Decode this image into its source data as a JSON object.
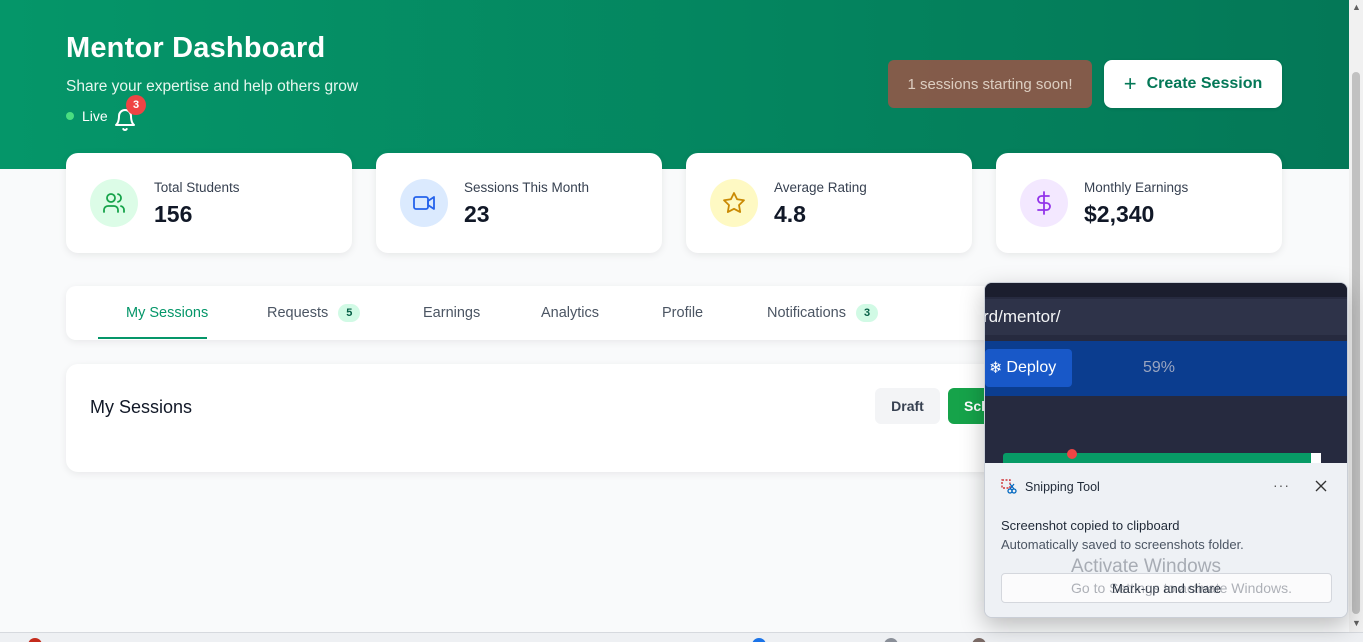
{
  "header": {
    "title": "Mentor Dashboard",
    "subtitle": "Share your expertise and help others grow",
    "live_label": "Live",
    "notification_count": "3",
    "toast": "1 sessions starting soon!",
    "create_label": "Create Session",
    "background_color": "#059669"
  },
  "stats": [
    {
      "label": "Total Students",
      "value": "156",
      "icon": "users-icon",
      "icon_bg": "#dcfce7",
      "icon_color": "#16a34a"
    },
    {
      "label": "Sessions This Month",
      "value": "23",
      "icon": "video-icon",
      "icon_bg": "#dbeafe",
      "icon_color": "#2563eb"
    },
    {
      "label": "Average Rating",
      "value": "4.8",
      "icon": "star-icon",
      "icon_bg": "#fef9c3",
      "icon_color": "#ca8a04"
    },
    {
      "label": "Monthly Earnings",
      "value": "$2,340",
      "icon": "dollar-icon",
      "icon_bg": "#f3e8ff",
      "icon_color": "#9333ea"
    }
  ],
  "tabs": [
    {
      "label": "My Sessions",
      "active": true
    },
    {
      "label": "Requests",
      "count": "5"
    },
    {
      "label": "Earnings"
    },
    {
      "label": "Analytics"
    },
    {
      "label": "Profile"
    },
    {
      "label": "Notifications",
      "count": "3"
    }
  ],
  "sessions": {
    "title": "My Sessions",
    "draft_label": "Draft",
    "schedule_label": "Sch"
  },
  "snipping_tool": {
    "app_name": "Snipping Tool",
    "more_label": "···",
    "message": "Screenshot copied to clipboard",
    "sub_message": "Automatically saved to screenshots folder.",
    "action_label": "Mark-up and share",
    "thumbnail": {
      "url_fragment": "rd/mentor/",
      "deploy_label": "Deploy",
      "progress_text": "59%"
    }
  },
  "watermark": {
    "title": "Activate Windows",
    "subtitle": "Go to Settings to activate Windows."
  }
}
